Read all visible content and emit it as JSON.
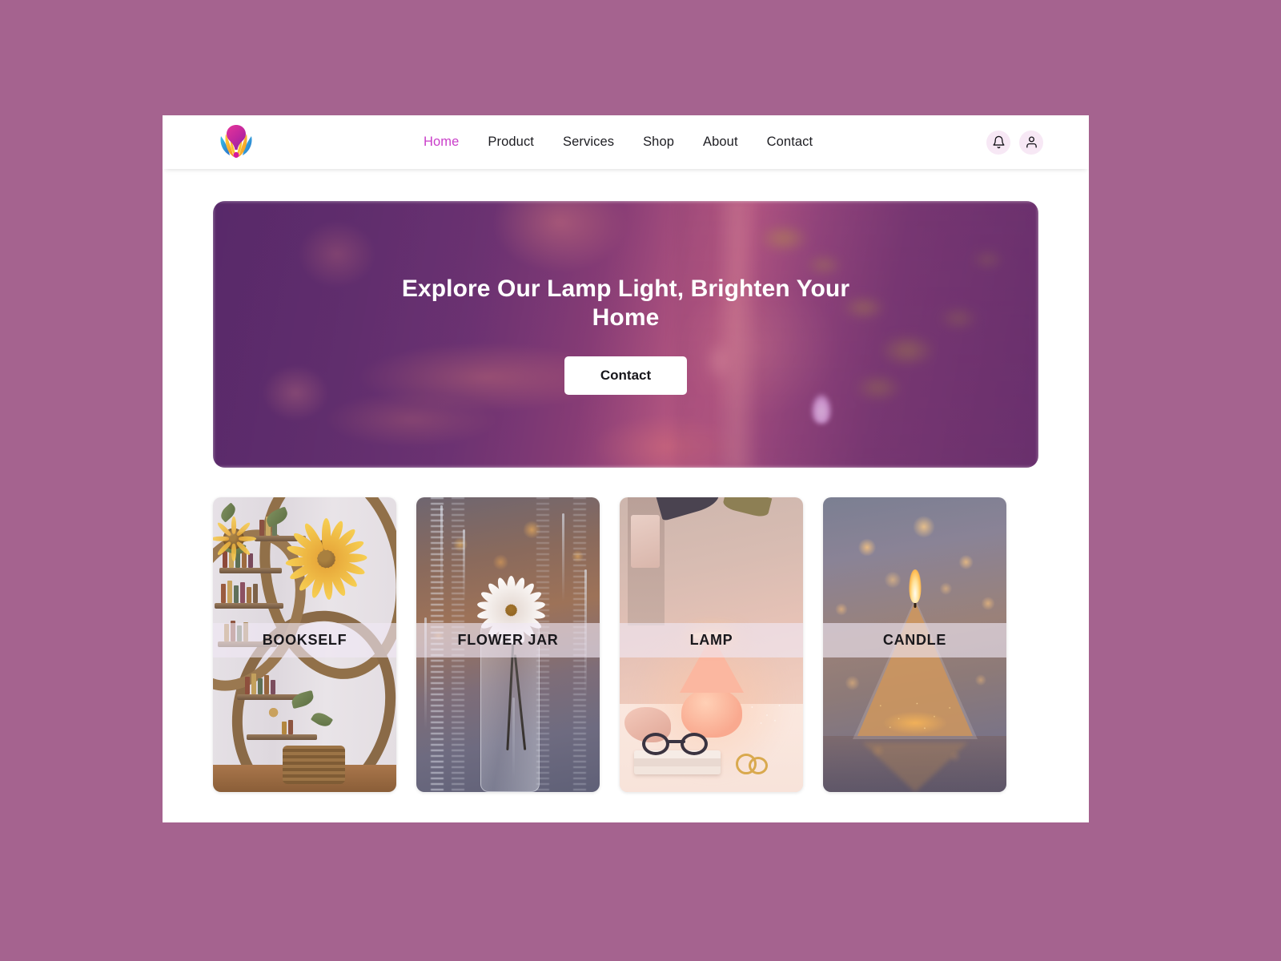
{
  "theme": {
    "page_background": "#a5638f",
    "surface": "#ffffff",
    "accent": "#c93ec9",
    "text": "#1d1d22",
    "icon_button_bg": "#f7e8f5"
  },
  "navbar": {
    "logo_name": "lotus-lamp-logo",
    "links": [
      {
        "label": "Home",
        "active": true
      },
      {
        "label": "Product",
        "active": false
      },
      {
        "label": "Services",
        "active": false
      },
      {
        "label": "Shop",
        "active": false
      },
      {
        "label": "About",
        "active": false
      },
      {
        "label": "Contact",
        "active": false
      }
    ],
    "actions": [
      {
        "icon": "bell-icon",
        "name": "notifications-button"
      },
      {
        "icon": "user-icon",
        "name": "account-button"
      }
    ]
  },
  "hero": {
    "title": "Explore Our Lamp Light, Brighten Your Home",
    "cta_label": "Contact",
    "image_description": "blurred warm purple interior with hanging lamps, foliage and a glowing candle"
  },
  "products": [
    {
      "label": "BOOKSELF",
      "art": "bookshelf",
      "image_description": "ornate curved wooden bookshelf with a large sunflower"
    },
    {
      "label": "FLOWER JAR",
      "art": "flowerjar",
      "image_description": "white daisy in a glass jar against a rainy window"
    },
    {
      "label": "LAMP",
      "art": "lamp",
      "image_description": "glowing mushroom table lamp on a nightstand with glasses and books"
    },
    {
      "label": "CANDLE",
      "art": "candle",
      "image_description": "lit pyramid glass candle with golden bokeh lights"
    }
  ]
}
